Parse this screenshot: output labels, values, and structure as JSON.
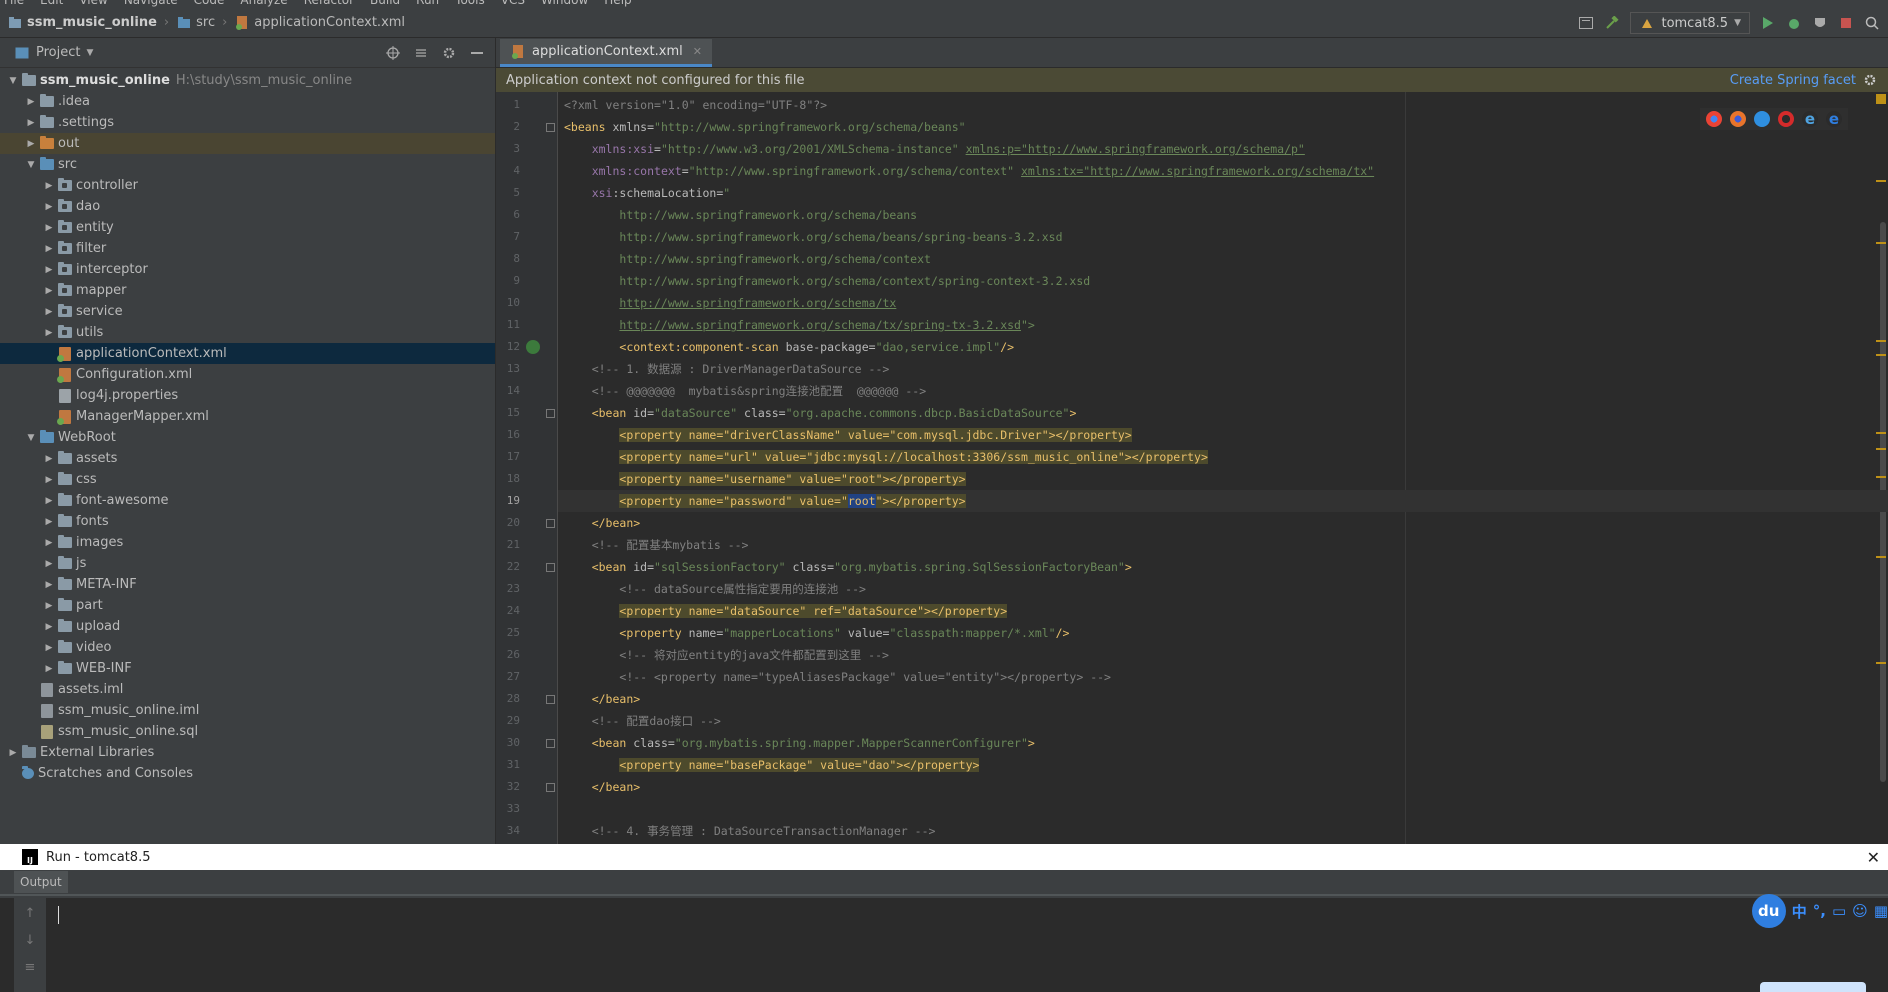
{
  "menu": [
    "File",
    "Edit",
    "View",
    "Navigate",
    "Code",
    "Analyze",
    "Refactor",
    "Build",
    "Run",
    "Tools",
    "VCS",
    "Window",
    "Help"
  ],
  "breadcrumb": {
    "project": "ssm_music_online",
    "folder": "src",
    "file": "applicationContext.xml"
  },
  "run_config": {
    "label": "tomcat8.5"
  },
  "project_panel": {
    "title": "Project",
    "tree": [
      {
        "depth": 0,
        "arrow": "▼",
        "type": "module",
        "label": "ssm_music_online",
        "meta": "H:\\study\\ssm_music_online",
        "bold": true
      },
      {
        "depth": 1,
        "arrow": "▶",
        "type": "folder-gray",
        "label": ".idea"
      },
      {
        "depth": 1,
        "arrow": "▶",
        "type": "folder-gray",
        "label": ".settings"
      },
      {
        "depth": 1,
        "arrow": "▶",
        "type": "folder-orange",
        "label": "out",
        "highlight": "out"
      },
      {
        "depth": 1,
        "arrow": "▼",
        "type": "folder-blue",
        "label": "src"
      },
      {
        "depth": 2,
        "arrow": "▶",
        "type": "package",
        "label": "controller"
      },
      {
        "depth": 2,
        "arrow": "▶",
        "type": "package",
        "label": "dao"
      },
      {
        "depth": 2,
        "arrow": "▶",
        "type": "package",
        "label": "entity"
      },
      {
        "depth": 2,
        "arrow": "▶",
        "type": "package",
        "label": "filter"
      },
      {
        "depth": 2,
        "arrow": "▶",
        "type": "package",
        "label": "interceptor"
      },
      {
        "depth": 2,
        "arrow": "▶",
        "type": "package",
        "label": "mapper"
      },
      {
        "depth": 2,
        "arrow": "▶",
        "type": "package",
        "label": "service"
      },
      {
        "depth": 2,
        "arrow": "▶",
        "type": "package",
        "label": "utils"
      },
      {
        "depth": 2,
        "arrow": "",
        "type": "xml",
        "label": "applicationContext.xml",
        "highlight": "sel"
      },
      {
        "depth": 2,
        "arrow": "",
        "type": "xml",
        "label": "Configuration.xml"
      },
      {
        "depth": 2,
        "arrow": "",
        "type": "prop",
        "label": "log4j.properties"
      },
      {
        "depth": 2,
        "arrow": "",
        "type": "xml",
        "label": "ManagerMapper.xml"
      },
      {
        "depth": 1,
        "arrow": "▼",
        "type": "folder-blue",
        "label": "WebRoot"
      },
      {
        "depth": 2,
        "arrow": "▶",
        "type": "folder-gray",
        "label": "assets"
      },
      {
        "depth": 2,
        "arrow": "▶",
        "type": "folder-gray",
        "label": "css"
      },
      {
        "depth": 2,
        "arrow": "▶",
        "type": "folder-gray",
        "label": "font-awesome"
      },
      {
        "depth": 2,
        "arrow": "▶",
        "type": "folder-gray",
        "label": "fonts"
      },
      {
        "depth": 2,
        "arrow": "▶",
        "type": "folder-gray",
        "label": "images"
      },
      {
        "depth": 2,
        "arrow": "▶",
        "type": "folder-gray",
        "label": "js"
      },
      {
        "depth": 2,
        "arrow": "▶",
        "type": "folder-gray",
        "label": "META-INF"
      },
      {
        "depth": 2,
        "arrow": "▶",
        "type": "folder-gray",
        "label": "part"
      },
      {
        "depth": 2,
        "arrow": "▶",
        "type": "folder-gray",
        "label": "upload"
      },
      {
        "depth": 2,
        "arrow": "▶",
        "type": "folder-gray",
        "label": "video"
      },
      {
        "depth": 2,
        "arrow": "▶",
        "type": "folder-gray",
        "label": "WEB-INF"
      },
      {
        "depth": 1,
        "arrow": "",
        "type": "iml",
        "label": "assets.iml"
      },
      {
        "depth": 1,
        "arrow": "",
        "type": "iml",
        "label": "ssm_music_online.iml"
      },
      {
        "depth": 1,
        "arrow": "",
        "type": "sql",
        "label": "ssm_music_online.sql"
      },
      {
        "depth": 0,
        "arrow": "▶",
        "type": "libs",
        "label": "External Libraries"
      },
      {
        "depth": 0,
        "arrow": "",
        "type": "scratch",
        "label": "Scratches and Consoles"
      }
    ]
  },
  "editor": {
    "tab": "applicationContext.xml",
    "banner_text": "Application context not configured for this file",
    "banner_link": "Create Spring facet",
    "current_line": 19,
    "lines": [
      [
        [
          "cm",
          "<?xml version=\"1.0\" encoding=\"UTF-8\"?>"
        ]
      ],
      [
        [
          "tg",
          "<beans "
        ],
        [
          "at",
          "xmlns="
        ],
        [
          "st",
          "\"http://www.springframework.org/schema/beans\""
        ]
      ],
      [
        [
          "",
          "    "
        ],
        [
          "ns",
          "xmlns:xsi"
        ],
        [
          "at",
          "="
        ],
        [
          "st",
          "\"http://www.w3.org/2001/XMLSchema-instance\" "
        ],
        [
          "ul",
          "xmlns:p=\"http://www.springframework.org/schema/p\""
        ]
      ],
      [
        [
          "",
          "    "
        ],
        [
          "ns",
          "xmlns:context"
        ],
        [
          "at",
          "="
        ],
        [
          "st",
          "\"http://www.springframework.org/schema/context\" "
        ],
        [
          "ul",
          "xmlns:tx=\"http://www.springframework.org/schema/tx\""
        ]
      ],
      [
        [
          "",
          "    "
        ],
        [
          "ns",
          "xsi"
        ],
        [
          "at",
          ":schemaLocation="
        ],
        [
          "st",
          "\""
        ]
      ],
      [
        [
          "",
          "        "
        ],
        [
          "st",
          "http://www.springframework.org/schema/beans"
        ]
      ],
      [
        [
          "",
          "        "
        ],
        [
          "st",
          "http://www.springframework.org/schema/beans/spring-beans-3.2.xsd"
        ]
      ],
      [
        [
          "",
          "        "
        ],
        [
          "st",
          "http://www.springframework.org/schema/context"
        ]
      ],
      [
        [
          "",
          "        "
        ],
        [
          "st",
          "http://www.springframework.org/schema/context/spring-context-3.2.xsd"
        ]
      ],
      [
        [
          "",
          "        "
        ],
        [
          "ul",
          "http://www.springframework.org/schema/tx"
        ]
      ],
      [
        [
          "",
          "        "
        ],
        [
          "ul",
          "http://www.springframework.org/schema/tx/spring-tx-3.2.xsd"
        ],
        [
          "st",
          "\">"
        ]
      ],
      [
        [
          "",
          "        "
        ],
        [
          "tg",
          "<context:component-scan "
        ],
        [
          "at",
          "base-package="
        ],
        [
          "st",
          "\"dao,service.impl\""
        ],
        [
          "tg",
          "/>"
        ]
      ],
      [
        [
          "",
          "    "
        ],
        [
          "cm",
          "<!-- 1. 数据源 : DriverManagerDataSource -->"
        ]
      ],
      [
        [
          "",
          "    "
        ],
        [
          "cm",
          "<!-- @@@@@@@  mybatis&spring连接池配置  @@@@@@ -->"
        ]
      ],
      [
        [
          "",
          "    "
        ],
        [
          "tg",
          "<bean "
        ],
        [
          "at",
          "id="
        ],
        [
          "st",
          "\"dataSource\" "
        ],
        [
          "at",
          "class="
        ],
        [
          "st",
          "\"org.apache.commons.dbcp.BasicDataSource\""
        ],
        [
          "tg",
          ">"
        ]
      ],
      [
        [
          "",
          "        "
        ],
        [
          "hl",
          "<property name=\"driverClassName\" value=\"com.mysql.jdbc.Driver\"></property>"
        ]
      ],
      [
        [
          "",
          "        "
        ],
        [
          "hl",
          "<property name=\"url\" value=\"jdbc:mysql://localhost:3306/ssm_music_online\"></property>"
        ]
      ],
      [
        [
          "",
          "        "
        ],
        [
          "hl",
          "<property name=\"username\" value=\"root\"></property>"
        ]
      ],
      [
        [
          "",
          "        "
        ],
        [
          "hl",
          "<property name=\"password\" value=\""
        ],
        [
          "sel",
          "root"
        ],
        [
          "hl",
          "\"></property>"
        ]
      ],
      [
        [
          "",
          "    "
        ],
        [
          "tg",
          "</bean>"
        ]
      ],
      [
        [
          "",
          "    "
        ],
        [
          "cm",
          "<!-- 配置基本mybatis -->"
        ]
      ],
      [
        [
          "",
          "    "
        ],
        [
          "tg",
          "<bean "
        ],
        [
          "at",
          "id="
        ],
        [
          "st",
          "\"sqlSessionFactory\" "
        ],
        [
          "at",
          "class="
        ],
        [
          "st",
          "\"org.mybatis.spring.SqlSessionFactoryBean\""
        ],
        [
          "tg",
          ">"
        ]
      ],
      [
        [
          "",
          "        "
        ],
        [
          "cm",
          "<!-- dataSource属性指定要用的连接池 -->"
        ]
      ],
      [
        [
          "",
          "        "
        ],
        [
          "hl",
          "<property name=\"dataSource\" ref=\"dataSource\"></property>"
        ]
      ],
      [
        [
          "",
          "        "
        ],
        [
          "tg",
          "<property "
        ],
        [
          "at",
          "name="
        ],
        [
          "st",
          "\"mapperLocations\" "
        ],
        [
          "at",
          "value="
        ],
        [
          "st",
          "\"classpath:mapper/*.xml\""
        ],
        [
          "tg",
          "/>"
        ]
      ],
      [
        [
          "",
          "        "
        ],
        [
          "cm",
          "<!-- 将对应entity的java文件都配置到这里 -->"
        ]
      ],
      [
        [
          "",
          "        "
        ],
        [
          "cm",
          "<!-- <property name=\"typeAliasesPackage\" value=\"entity\"></property> -->"
        ]
      ],
      [
        [
          "",
          "    "
        ],
        [
          "tg",
          "</bean>"
        ]
      ],
      [
        [
          "",
          "    "
        ],
        [
          "cm",
          "<!-- 配置dao接口 -->"
        ]
      ],
      [
        [
          "",
          "    "
        ],
        [
          "tg",
          "<bean "
        ],
        [
          "at",
          "class="
        ],
        [
          "st",
          "\"org.mybatis.spring.mapper.MapperScannerConfigurer\""
        ],
        [
          "tg",
          ">"
        ]
      ],
      [
        [
          "",
          "        "
        ],
        [
          "hl",
          "<property name=\"basePackage\" value=\"dao\"></property>"
        ]
      ],
      [
        [
          "",
          "    "
        ],
        [
          "tg",
          "</bean>"
        ]
      ],
      [
        [
          "",
          ""
        ]
      ],
      [
        [
          "",
          "    "
        ],
        [
          "cm",
          "<!-- 4. 事务管理 : DataSourceTransactionManager -->"
        ]
      ]
    ]
  },
  "run_window": {
    "title": "Run - tomcat8.5",
    "tab": "Output"
  },
  "ime": {
    "brand": "du",
    "lang": "中",
    "punct": "°,"
  },
  "colors": {
    "banner": "#4b4a35",
    "link": "#589df6",
    "selection": "#0d293e",
    "accent": "#4a88c7"
  }
}
